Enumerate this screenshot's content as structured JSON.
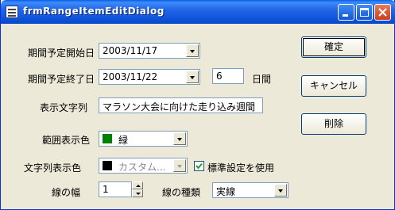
{
  "window": {
    "title": "frmRangeItemEditDialog"
  },
  "form": {
    "start_label": "期間予定開始日",
    "start_value": "2003/11/17",
    "end_label": "期間予定終了日",
    "end_value": "2003/11/22",
    "days_value": "6",
    "days_unit": "日間",
    "text_label": "表示文字列",
    "text_value": "マラソン大会に向けた走り込み週間",
    "range_color_label": "範囲表示色",
    "range_color_value": "緑",
    "range_color_hex": "#008000",
    "text_color_label": "文字列表示色",
    "text_color_value": "カスタム...",
    "text_color_hex": "#000000",
    "use_default_label": "標準設定を使用",
    "use_default_checked": true,
    "line_width_label": "線の幅",
    "line_width_value": "1",
    "line_type_label": "線の種類",
    "line_type_value": "実線"
  },
  "buttons": {
    "ok": "確定",
    "cancel": "キャンセル",
    "delete": "削除"
  }
}
